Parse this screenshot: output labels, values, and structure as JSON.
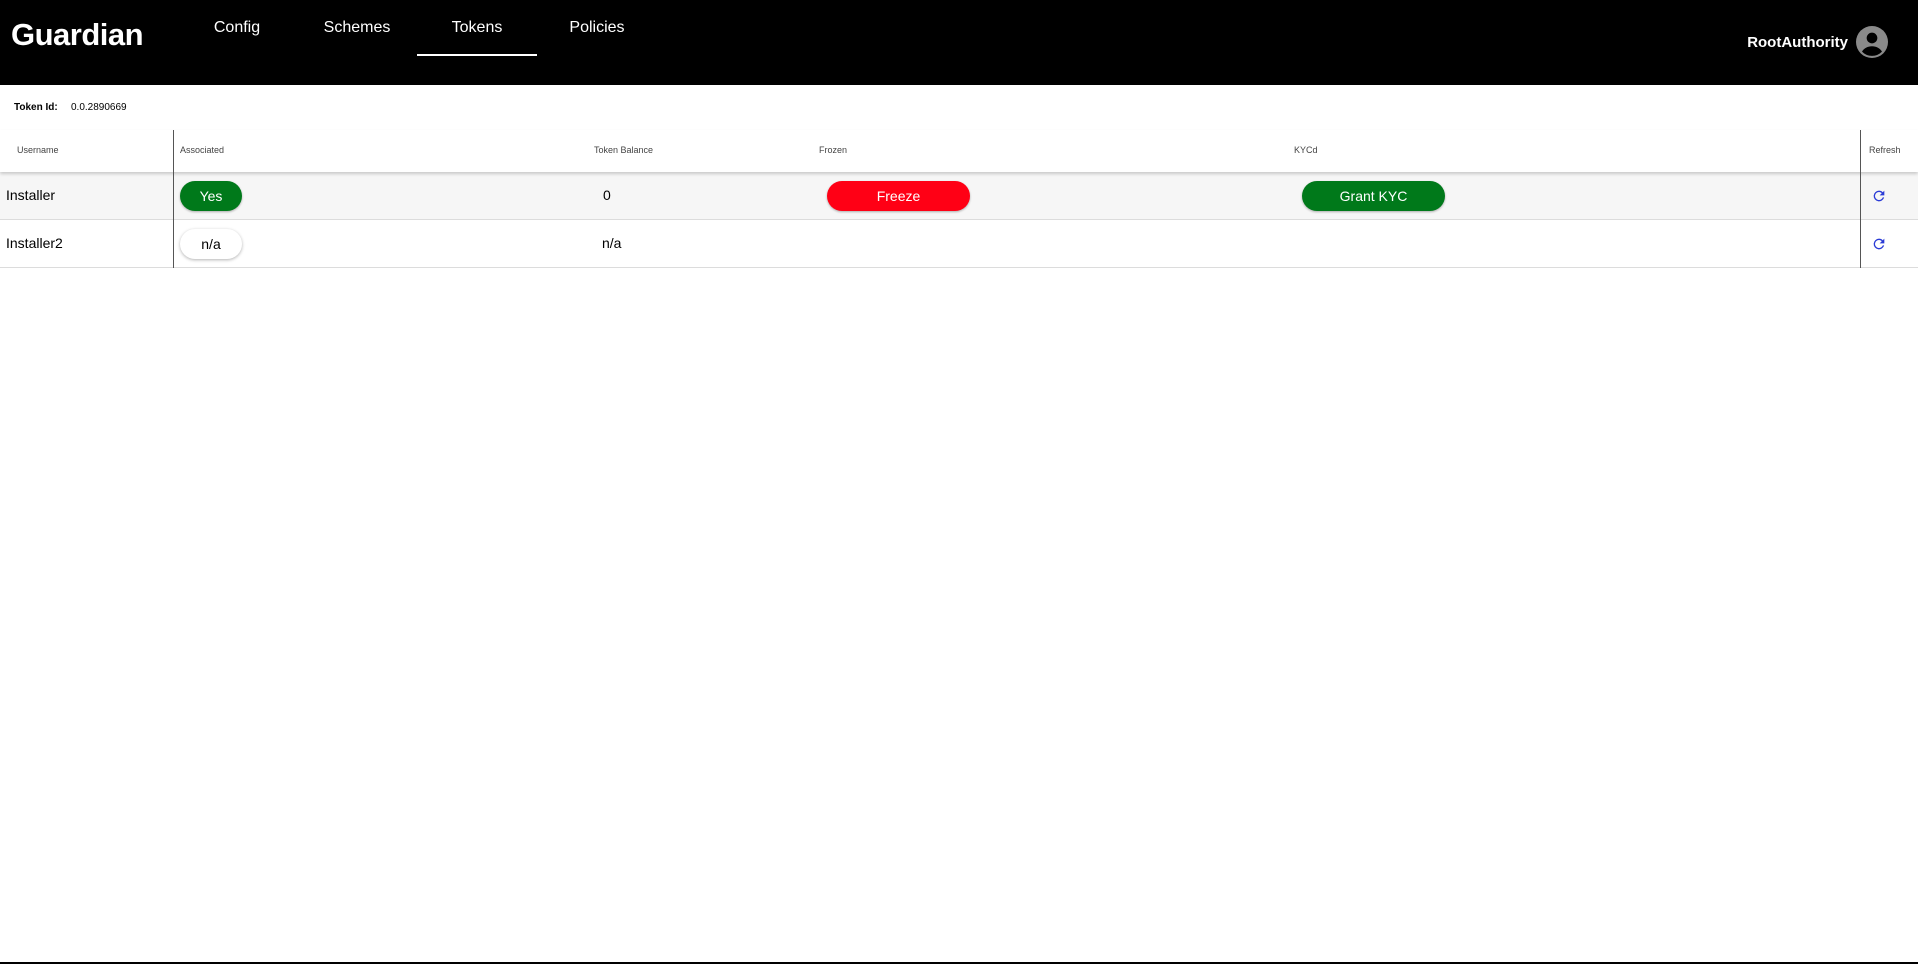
{
  "app": {
    "brand": "Guardian",
    "colors": {
      "header_bg": "#000000",
      "success": "#00791a",
      "danger": "#ff0015",
      "refresh_icon": "#2a3bd6"
    }
  },
  "nav": {
    "tabs": [
      {
        "label": "Config",
        "active": false
      },
      {
        "label": "Schemes",
        "active": false
      },
      {
        "label": "Tokens",
        "active": true
      },
      {
        "label": "Policies",
        "active": false
      }
    ]
  },
  "user": {
    "name": "RootAuthority",
    "icon": "account-circle-icon"
  },
  "token": {
    "label": "Token Id:",
    "value": "0.0.2890669"
  },
  "table": {
    "columns": [
      "Username",
      "Associated",
      "Token Balance",
      "Frozen",
      "KYCd",
      "Refresh"
    ],
    "rows": [
      {
        "username": "Installer",
        "associated": "Yes",
        "balance": "0",
        "frozen_action": "Freeze",
        "kyc_action": "Grant KYC",
        "refresh_icon": "refresh-icon"
      },
      {
        "username": "Installer2",
        "associated": "n/a",
        "balance": "n/a",
        "frozen_action": "",
        "kyc_action": "",
        "refresh_icon": "refresh-icon"
      }
    ]
  }
}
